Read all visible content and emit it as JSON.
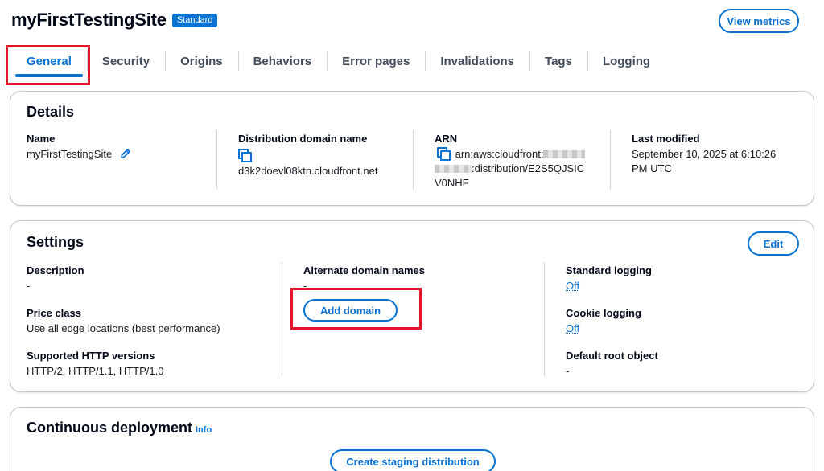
{
  "header": {
    "title": "myFirstTestingSite",
    "badge": "Standard",
    "view_metrics_label": "View metrics"
  },
  "tabs": [
    {
      "label": "General",
      "active": true
    },
    {
      "label": "Security"
    },
    {
      "label": "Origins"
    },
    {
      "label": "Behaviors"
    },
    {
      "label": "Error pages"
    },
    {
      "label": "Invalidations"
    },
    {
      "label": "Tags"
    },
    {
      "label": "Logging"
    }
  ],
  "details": {
    "title": "Details",
    "name_label": "Name",
    "name_value": "myFirstTestingSite",
    "domain_label": "Distribution domain name",
    "domain_value": "d3k2doevl08ktn.cloudfront.net",
    "arn_label": "ARN",
    "arn_line1": "arn:aws:cloudfront:",
    "arn_line2": ":distribution/E2S5QJSIC",
    "arn_line3": "V0NHF",
    "modified_label": "Last modified",
    "modified_line1": "September 10, 2025 at 6:10:26",
    "modified_line2": "PM UTC"
  },
  "settings": {
    "title": "Settings",
    "edit_label": "Edit",
    "description_label": "Description",
    "description_value": "-",
    "price_class_label": "Price class",
    "price_class_value": "Use all edge locations (best performance)",
    "http_versions_label": "Supported HTTP versions",
    "http_versions_value": "HTTP/2, HTTP/1.1, HTTP/1.0",
    "alt_domains_label": "Alternate domain names",
    "alt_domains_value": "-",
    "add_domain_label": "Add domain",
    "std_logging_label": "Standard logging",
    "std_logging_value": "Off",
    "cookie_logging_label": "Cookie logging",
    "cookie_logging_value": "Off",
    "default_root_label": "Default root object",
    "default_root_value": "-"
  },
  "continuous": {
    "title": "Continuous deployment",
    "info_label": "Info",
    "create_staging_label": "Create staging distribution"
  },
  "colors": {
    "accent": "#0972d3",
    "highlight": "#e3162b",
    "text": "#16191f"
  }
}
